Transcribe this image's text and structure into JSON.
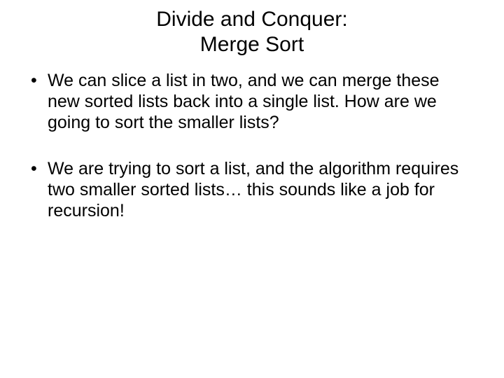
{
  "title": {
    "line1": "Divide and Conquer:",
    "line2": "Merge Sort"
  },
  "bullets": [
    "We can slice a list in two, and we can merge these new sorted lists back into a single list. How are we going to sort the smaller lists?",
    "We are trying to sort a list, and the algorithm requires two smaller sorted lists… this sounds like a job for recursion!"
  ]
}
